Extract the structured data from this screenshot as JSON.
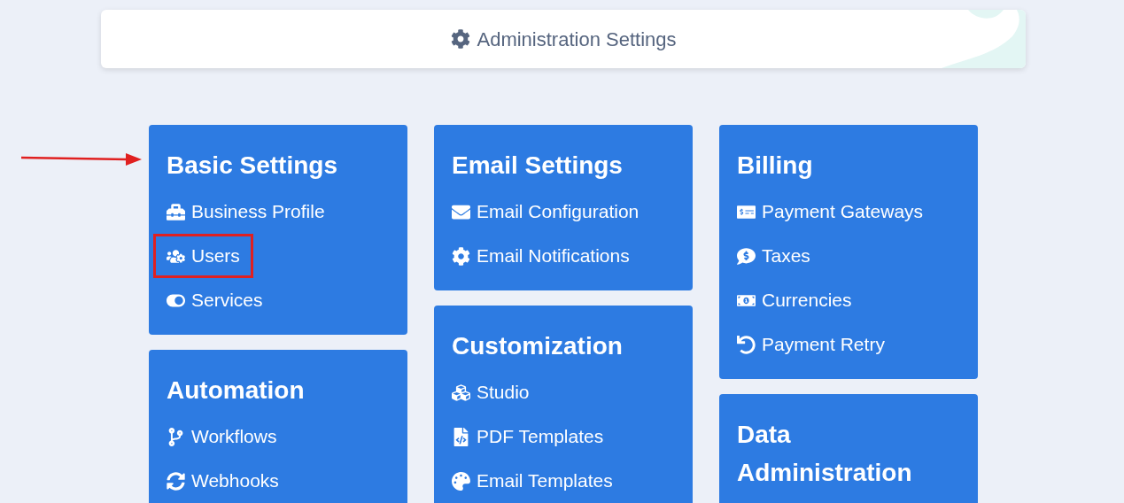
{
  "header": {
    "title": "Administration Settings"
  },
  "pointer_arrow": true,
  "columns": [
    [
      {
        "title": "Basic Settings",
        "items": [
          {
            "label": "Business Profile",
            "highlighted": false
          },
          {
            "label": "Users",
            "highlighted": true
          },
          {
            "label": "Services",
            "highlighted": false
          }
        ]
      },
      {
        "title": "Automation",
        "items": [
          {
            "label": "Workflows",
            "highlighted": false
          },
          {
            "label": "Webhooks",
            "highlighted": false
          }
        ]
      }
    ],
    [
      {
        "title": "Email Settings",
        "items": [
          {
            "label": "Email Configuration",
            "highlighted": false
          },
          {
            "label": "Email Notifications",
            "highlighted": false
          }
        ]
      },
      {
        "title": "Customization",
        "items": [
          {
            "label": "Studio",
            "highlighted": false
          },
          {
            "label": "PDF Templates",
            "highlighted": false
          },
          {
            "label": "Email Templates",
            "highlighted": false
          }
        ]
      }
    ],
    [
      {
        "title": "Billing",
        "items": [
          {
            "label": "Payment Gateways",
            "highlighted": false
          },
          {
            "label": "Taxes",
            "highlighted": false
          },
          {
            "label": "Currencies",
            "highlighted": false
          },
          {
            "label": "Payment Retry",
            "highlighted": false
          }
        ]
      },
      {
        "title": "Data Administration"
      }
    ]
  ]
}
